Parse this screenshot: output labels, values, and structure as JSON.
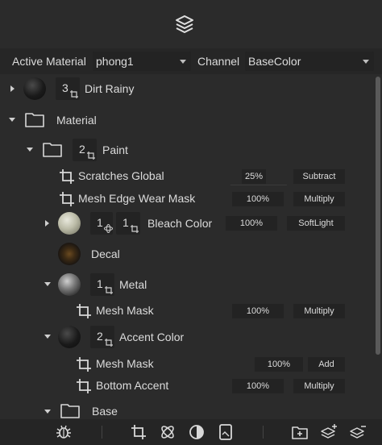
{
  "header": {
    "icon": "layers-icon"
  },
  "selectors": {
    "active_material_label": "Active Material",
    "active_material_value": "phong1",
    "channel_label": "Channel",
    "channel_value": "BaseColor"
  },
  "layers": {
    "dirt_rainy": {
      "count": "3",
      "name": "Dirt Rainy"
    },
    "material": {
      "name": "Material"
    },
    "paint": {
      "count": "2",
      "name": "Paint"
    },
    "scratches_global": {
      "name": "Scratches Global",
      "opacity": "25%",
      "blend": "Subtract"
    },
    "mesh_edge_wear": {
      "name": "Mesh Edge Wear Mask",
      "opacity": "100%",
      "blend": "Multiply"
    },
    "bleach_color": {
      "count_a": "1",
      "count_b": "1",
      "name": "Bleach Color",
      "opacity": "100%",
      "blend": "SoftLight"
    },
    "decal": {
      "name": "Decal"
    },
    "metal": {
      "count": "1",
      "name": "Metal"
    },
    "metal_mesh_mask": {
      "name": "Mesh Mask",
      "opacity": "100%",
      "blend": "Multiply"
    },
    "accent_color": {
      "count": "2",
      "name": "Accent Color"
    },
    "accent_mesh_mask": {
      "name": "Mesh Mask",
      "opacity": "100%",
      "blend": "Add"
    },
    "bottom_accent": {
      "name": "Bottom Accent",
      "opacity": "100%",
      "blend": "Multiply"
    },
    "base": {
      "name": "Base"
    }
  },
  "footer": {
    "icons": [
      "bug-icon",
      "crop-mask-icon",
      "atom-icon",
      "contrast-icon",
      "image-frame-icon",
      "add-folder-icon",
      "add-layer-icon",
      "remove-layer-icon"
    ]
  }
}
